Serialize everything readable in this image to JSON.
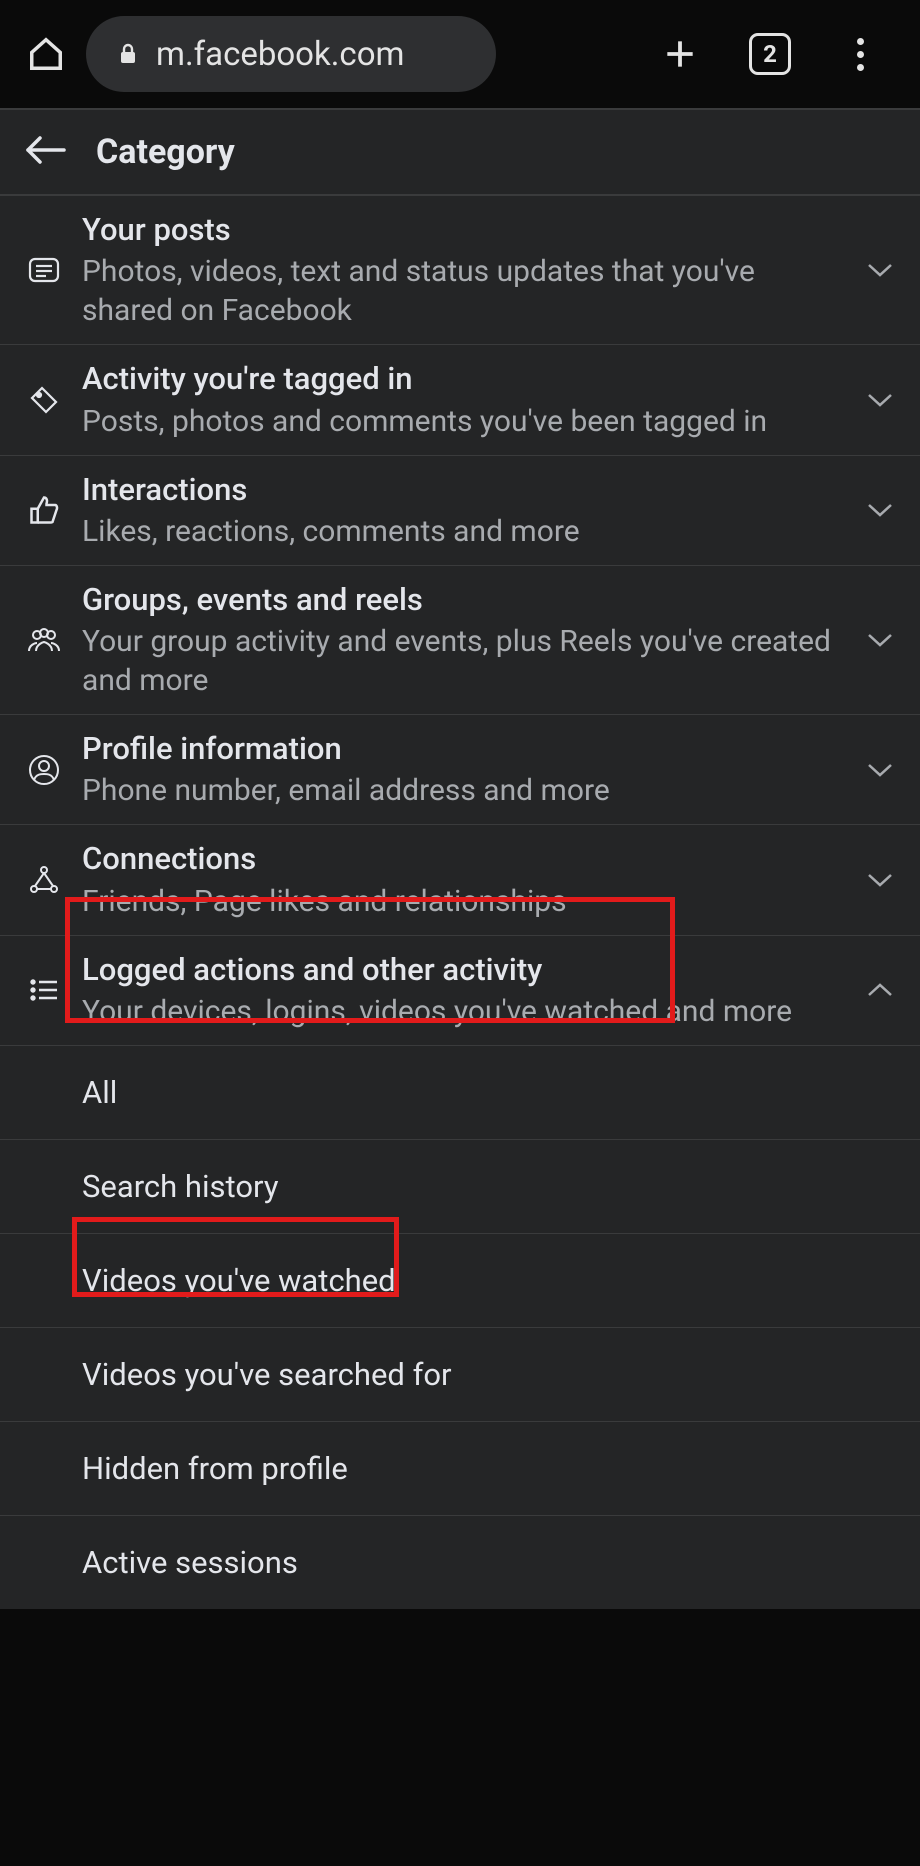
{
  "browser": {
    "url": "m.facebook.com",
    "tab_count": "2"
  },
  "header": {
    "title": "Category"
  },
  "categories": [
    {
      "title": "Your posts",
      "subtitle": "Photos, videos, text and status updates that you've shared on Facebook",
      "expanded": false
    },
    {
      "title": "Activity you're tagged in",
      "subtitle": "Posts, photos and comments you've been tagged in",
      "expanded": false
    },
    {
      "title": "Interactions",
      "subtitle": "Likes, reactions, comments and more",
      "expanded": false
    },
    {
      "title": "Groups, events and reels",
      "subtitle": "Your group activity and events, plus Reels you've created and more",
      "expanded": false
    },
    {
      "title": "Profile information",
      "subtitle": "Phone number, email address and more",
      "expanded": false
    },
    {
      "title": "Connections",
      "subtitle": "Friends, Page likes and relationships",
      "expanded": false
    },
    {
      "title": "Logged actions and other activity",
      "subtitle": "Your devices, logins, videos you've watched and more",
      "expanded": true
    }
  ],
  "sub_items": [
    "All",
    "Search history",
    "Videos you've watched",
    "Videos you've searched for",
    "Hidden from profile",
    "Active sessions"
  ]
}
